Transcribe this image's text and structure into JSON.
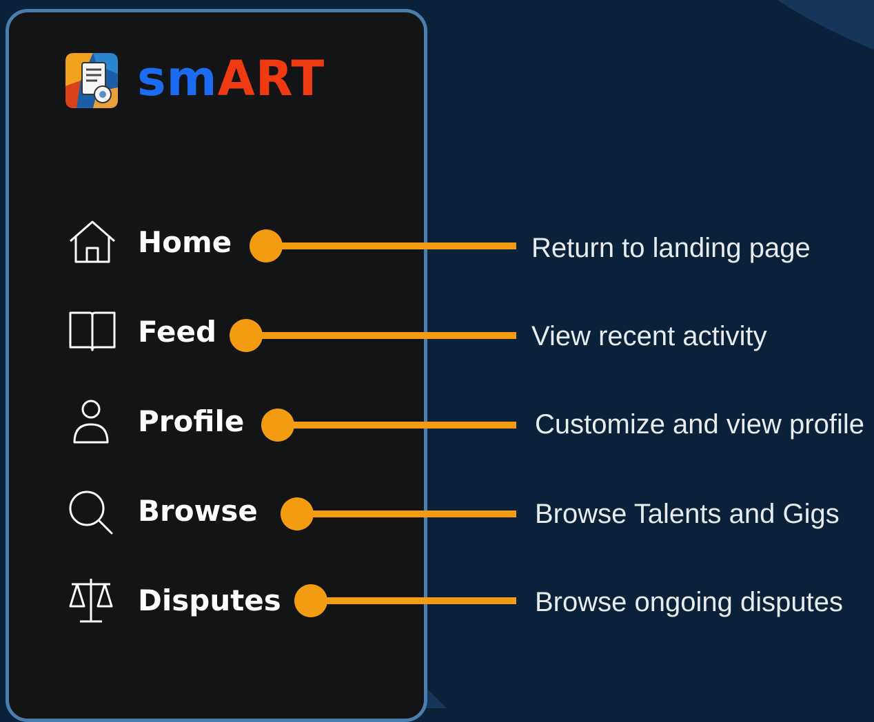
{
  "brand": {
    "part1": "sm",
    "part2": "ART",
    "logo_icon": "certificate-logo-icon"
  },
  "nav": [
    {
      "label": "Home",
      "icon": "home-icon",
      "description": "Return to landing page"
    },
    {
      "label": "Feed",
      "icon": "book-icon",
      "description": "View recent activity"
    },
    {
      "label": "Profile",
      "icon": "user-icon",
      "description": "Customize and view profile"
    },
    {
      "label": "Browse",
      "icon": "search-icon",
      "description": "Browse Talents and Gigs"
    },
    {
      "label": "Disputes",
      "icon": "scales-icon",
      "description": "Browse ongoing disputes"
    }
  ],
  "colors": {
    "background": "#0b2139",
    "sidebar": "#131416",
    "sidebar_border": "#4a7eaf",
    "connector": "#f39c12",
    "brand_blue": "#1b6cf2",
    "brand_red": "#ef3a12"
  }
}
